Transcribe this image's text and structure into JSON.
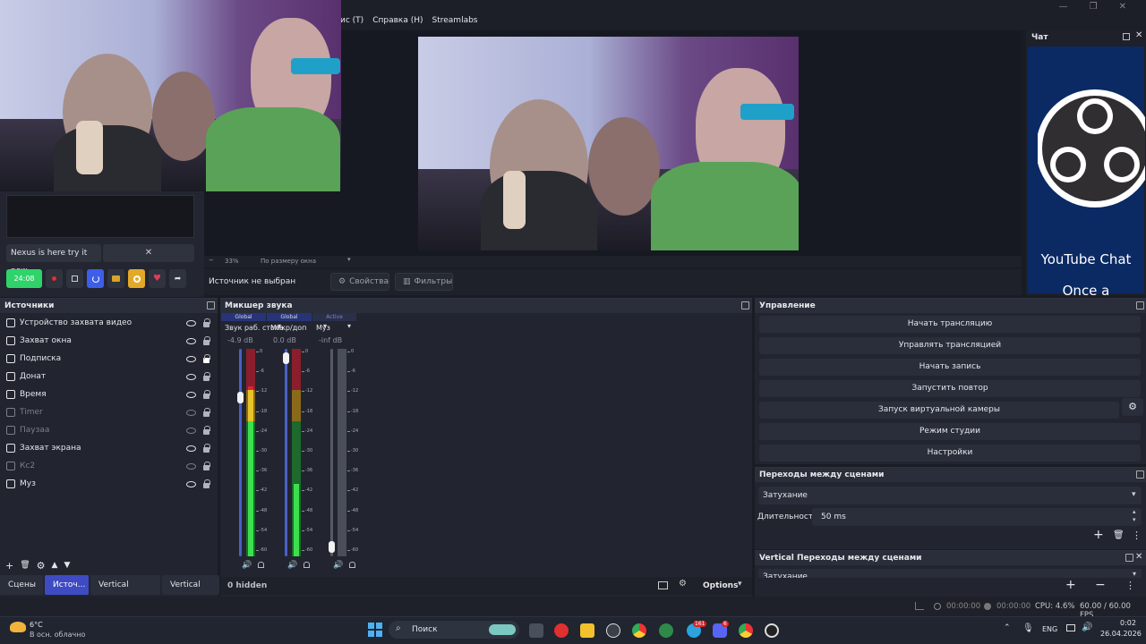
{
  "menu": {
    "items": [
      "ис (T)",
      "Справка (H)",
      "Streamlabs"
    ]
  },
  "window": {
    "controls": [
      "—",
      "❐",
      "✕"
    ]
  },
  "widget": {
    "nexus_text": "Nexus is here try it now",
    "close_glyph": "✕",
    "timer": "24:08"
  },
  "zoom": {
    "minus": "−",
    "percent": "33%",
    "fit": "По размеру окна"
  },
  "properties_bar": {
    "no_source": "Источник не выбран",
    "properties_label": "Свойства",
    "filters_label": "Фильтры"
  },
  "chat": {
    "title": "Чат",
    "youtube_chat": "YouTube Chat",
    "once": "Once a"
  },
  "sources": {
    "title": "Источники",
    "items": [
      {
        "label": "Устройство захвата видео",
        "icon": "camera-icon",
        "visible": true,
        "locked": false
      },
      {
        "label": "Захват окна",
        "icon": "window-icon",
        "visible": true,
        "locked": false
      },
      {
        "label": "Подписка",
        "icon": "browser-icon",
        "visible": true,
        "locked": true
      },
      {
        "label": "Донат",
        "icon": "browser-icon",
        "visible": true,
        "locked": false
      },
      {
        "label": "Время",
        "icon": "browser-icon",
        "visible": true,
        "locked": false
      },
      {
        "label": "Timer",
        "icon": "text-icon",
        "visible": false,
        "locked": false
      },
      {
        "label": "Паузаа",
        "icon": "image-icon",
        "visible": false,
        "locked": false
      },
      {
        "label": "Захват экрана",
        "icon": "monitor-icon",
        "visible": true,
        "locked": false
      },
      {
        "label": "Кс2",
        "icon": "window-icon",
        "visible": false,
        "locked": false
      },
      {
        "label": "Муз",
        "icon": "play-icon",
        "visible": true,
        "locked": false
      }
    ],
    "toolbar": [
      "+",
      "🗑",
      "⚙",
      "▲",
      "▼"
    ]
  },
  "tabs": [
    {
      "label": "Сцены",
      "active": false
    },
    {
      "label": "Источ...",
      "active": true
    },
    {
      "label": "Vertical Исто...",
      "active": false
    },
    {
      "label": "Vertical C...",
      "active": false
    }
  ],
  "mixer": {
    "title": "Микшер звука",
    "hidden": "0 hidden",
    "options": "Options",
    "channels": [
      {
        "tag": "Global",
        "name": "Звук раб. стола",
        "db": "-4.9 dB",
        "level": 0.82,
        "fader": 0.78
      },
      {
        "tag": "Global",
        "name": "Микр/доп",
        "db": "0.0 dB",
        "level": 0.35,
        "fader": 0.98
      },
      {
        "tag": "Active",
        "name": "Муз",
        "db": "-inf dB",
        "level": 0.0,
        "fader": 0.02
      }
    ],
    "ticks": [
      "0",
      "-6",
      "-12",
      "-18",
      "-24",
      "-30",
      "-36",
      "-42",
      "-48",
      "-54",
      "-60"
    ]
  },
  "controls": {
    "title": "Управление",
    "buttons": [
      "Начать трансляцию",
      "Управлять трансляцией",
      "Начать запись",
      "Запустить повтор",
      "Запуск виртуальной камеры",
      "Режим студии",
      "Настройки"
    ]
  },
  "transitions": {
    "title": "Переходы между сценами",
    "type": "Затухание",
    "duration_label": "Длительность",
    "duration": "50 ms"
  },
  "vertical_transitions": {
    "title": "Vertical Переходы между сценами",
    "type": "Затухание"
  },
  "status": {
    "stream_time": "00:00:00",
    "rec_time": "00:00:00",
    "cpu": "CPU: 4.6%",
    "fps": "60.00 / 60.00 FPS"
  },
  "taskbar": {
    "temp": "6°C",
    "weather": "В осн. облачно",
    "search": "Поиск",
    "lang": "ENG",
    "time": "0:02",
    "date": "26.04.2026",
    "badge_telegram": "161",
    "badge_discord": "6"
  },
  "colors": {
    "accent": "#3e4bc2",
    "green": "#2fd36a",
    "chat_blue": "#0b2a63"
  }
}
